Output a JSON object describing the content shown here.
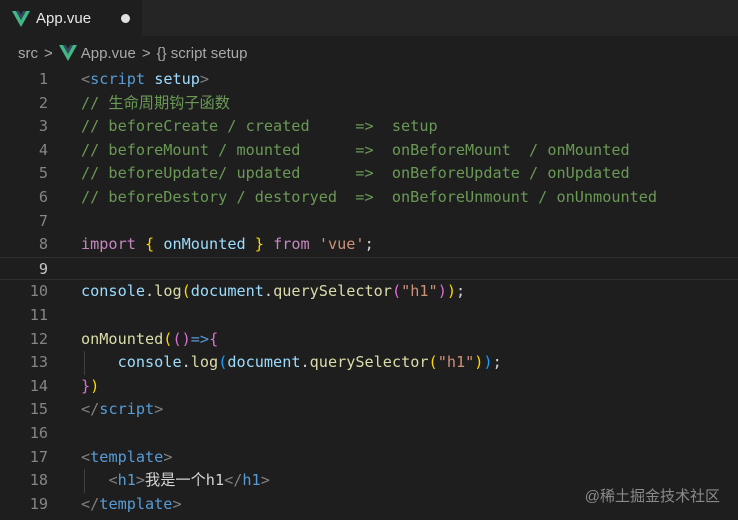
{
  "tab": {
    "title": "App.vue",
    "icon": "vue-icon",
    "modified": true
  },
  "breadcrumb": {
    "part1": "src",
    "sep": ">",
    "part2": "App.vue",
    "part3": "{} script setup"
  },
  "colors": {
    "vue_green": "#41b883",
    "background": "#1e1e1e"
  },
  "lines": [
    {
      "n": "1",
      "t": [
        [
          "<",
          "tag"
        ],
        [
          "script",
          "kw"
        ],
        [
          " ",
          "pl"
        ],
        [
          "setup",
          "attr"
        ],
        [
          ">",
          "tag"
        ]
      ]
    },
    {
      "n": "2",
      "t": [
        [
          "// 生命周期钩子函数",
          "cmt"
        ]
      ]
    },
    {
      "n": "3",
      "t": [
        [
          "// beforeCreate / created     =>  setup",
          "cmt"
        ]
      ]
    },
    {
      "n": "4",
      "t": [
        [
          "// beforeMount / mounted      =>  onBeforeMount  / onMounted",
          "cmt"
        ]
      ]
    },
    {
      "n": "5",
      "t": [
        [
          "// beforeUpdate/ updated      =>  onBeforeUpdate / onUpdated",
          "cmt"
        ]
      ]
    },
    {
      "n": "6",
      "t": [
        [
          "// beforeDestory / destoryed  =>  onBeforeUnmount / onUnmounted",
          "cmt"
        ]
      ]
    },
    {
      "n": "7",
      "t": []
    },
    {
      "n": "8",
      "t": [
        [
          "import",
          "imp"
        ],
        [
          " ",
          "pl"
        ],
        [
          "{",
          "br1"
        ],
        [
          " ",
          "pl"
        ],
        [
          "onMounted",
          "var"
        ],
        [
          " ",
          "pl"
        ],
        [
          "}",
          "br1"
        ],
        [
          " ",
          "pl"
        ],
        [
          "from",
          "imp"
        ],
        [
          " ",
          "pl"
        ],
        [
          "'vue'",
          "str"
        ],
        [
          ";",
          "pl"
        ]
      ]
    },
    {
      "n": "9",
      "t": [],
      "current": true
    },
    {
      "n": "10",
      "t": [
        [
          "console",
          "var"
        ],
        [
          ".",
          "pl"
        ],
        [
          "log",
          "fn"
        ],
        [
          "(",
          "br1"
        ],
        [
          "document",
          "var"
        ],
        [
          ".",
          "pl"
        ],
        [
          "querySelector",
          "fn"
        ],
        [
          "(",
          "br2"
        ],
        [
          "\"h1\"",
          "str"
        ],
        [
          ")",
          "br2"
        ],
        [
          ")",
          "br1"
        ],
        [
          ";",
          "pl"
        ]
      ]
    },
    {
      "n": "11",
      "t": []
    },
    {
      "n": "12",
      "t": [
        [
          "onMounted",
          "fn"
        ],
        [
          "(",
          "br1"
        ],
        [
          "(",
          "br2"
        ],
        [
          ")",
          "br2"
        ],
        [
          "=>",
          "kw"
        ],
        [
          "{",
          "br2"
        ]
      ]
    },
    {
      "n": "13",
      "t": [
        [
          "    ",
          "pl"
        ],
        [
          "console",
          "var"
        ],
        [
          ".",
          "pl"
        ],
        [
          "log",
          "fn"
        ],
        [
          "(",
          "br3"
        ],
        [
          "document",
          "var"
        ],
        [
          ".",
          "pl"
        ],
        [
          "querySelector",
          "fn"
        ],
        [
          "(",
          "br1"
        ],
        [
          "\"h1\"",
          "str"
        ],
        [
          ")",
          "br1"
        ],
        [
          ")",
          "br3"
        ],
        [
          ";",
          "pl"
        ]
      ]
    },
    {
      "n": "14",
      "t": [
        [
          "}",
          "br2"
        ],
        [
          ")",
          "br1"
        ]
      ]
    },
    {
      "n": "15",
      "t": [
        [
          "</",
          "tag"
        ],
        [
          "script",
          "kw"
        ],
        [
          ">",
          "tag"
        ]
      ]
    },
    {
      "n": "16",
      "t": []
    },
    {
      "n": "17",
      "t": [
        [
          "<",
          "tag"
        ],
        [
          "template",
          "kw"
        ],
        [
          ">",
          "tag"
        ]
      ]
    },
    {
      "n": "18",
      "t": [
        [
          "   ",
          "pl"
        ],
        [
          "<",
          "tag"
        ],
        [
          "h1",
          "kw"
        ],
        [
          ">",
          "tag"
        ],
        [
          "我是一个h1",
          "txt"
        ],
        [
          "</",
          "tag"
        ],
        [
          "h1",
          "kw"
        ],
        [
          ">",
          "tag"
        ]
      ]
    },
    {
      "n": "19",
      "t": [
        [
          "</",
          "tag"
        ],
        [
          "template",
          "kw"
        ],
        [
          ">",
          "tag"
        ]
      ]
    }
  ],
  "watermark": "@稀土掘金技术社区"
}
